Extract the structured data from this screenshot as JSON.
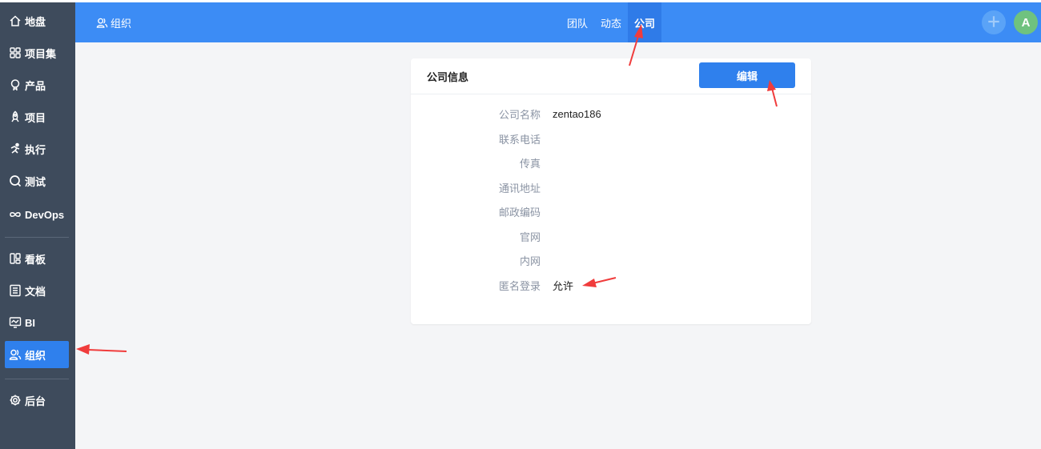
{
  "sidebar": {
    "items": [
      {
        "label": "地盘",
        "icon": "home-icon"
      },
      {
        "label": "项目集",
        "icon": "grid-icon"
      },
      {
        "label": "产品",
        "icon": "lightbulb-icon"
      },
      {
        "label": "项目",
        "icon": "rocket-icon"
      },
      {
        "label": "执行",
        "icon": "run-icon"
      },
      {
        "label": "测试",
        "icon": "magnifier-icon"
      },
      {
        "label": "DevOps",
        "icon": "infinity-icon"
      },
      {
        "label": "看板",
        "icon": "kanban-icon"
      },
      {
        "label": "文档",
        "icon": "document-icon"
      },
      {
        "label": "BI",
        "icon": "monitor-icon"
      },
      {
        "label": "组织",
        "icon": "users-icon",
        "active": true
      },
      {
        "label": "后台",
        "icon": "gear-icon"
      }
    ]
  },
  "topbar": {
    "crumb": "组织",
    "tabs": [
      {
        "label": "团队"
      },
      {
        "label": "动态"
      },
      {
        "label": "公司",
        "active": true
      }
    ],
    "avatar_letter": "A"
  },
  "card": {
    "title": "公司信息",
    "edit_label": "编辑",
    "fields": [
      {
        "label": "公司名称",
        "value": "zentao186"
      },
      {
        "label": "联系电话",
        "value": ""
      },
      {
        "label": "传真",
        "value": ""
      },
      {
        "label": "通讯地址",
        "value": ""
      },
      {
        "label": "邮政编码",
        "value": ""
      },
      {
        "label": "官网",
        "value": ""
      },
      {
        "label": "内网",
        "value": ""
      },
      {
        "label": "匿名登录",
        "value": "允许"
      }
    ]
  },
  "colors": {
    "sidebar_bg": "#3e4b5c",
    "topbar_bg": "#3c8cf5",
    "primary": "#2f80ed",
    "avatar_bg": "#6fc27f",
    "annotation_arrow": "#f03c3c"
  }
}
